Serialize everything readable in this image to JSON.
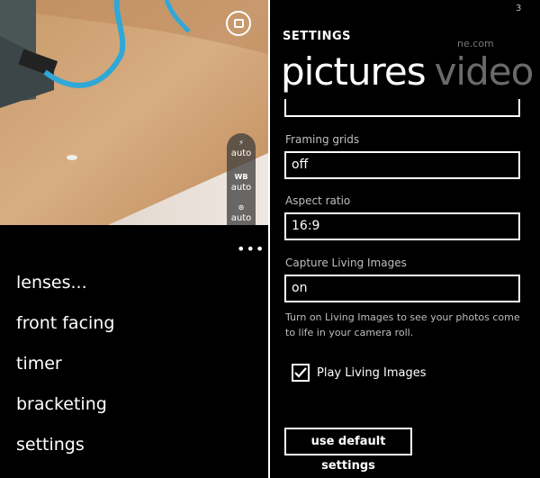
{
  "camera": {
    "switch_icon": "camera-switch-icon",
    "quick_settings": [
      {
        "icon": "flash-icon",
        "symbol": "⚡",
        "value": "auto"
      },
      {
        "icon": "white-balance-icon",
        "symbol": "WB",
        "value": "auto"
      },
      {
        "icon": "exposure-icon",
        "symbol": "⊙",
        "value": "auto"
      }
    ],
    "more_icon": "•••"
  },
  "menu": {
    "items": [
      "lenses...",
      "front facing",
      "timer",
      "bracketing",
      "settings"
    ]
  },
  "settings": {
    "status_number": "3",
    "watermark": "ne.com",
    "title": "SETTINGS",
    "pivot_active": "pictures",
    "pivot_inactive": "video",
    "framing_grids_label": "Framing grids",
    "framing_grids_value": "off",
    "aspect_ratio_label": "Aspect ratio",
    "aspect_ratio_value": "16:9",
    "living_images_label": "Capture Living Images",
    "living_images_value": "on",
    "living_help": "Turn on Living Images to see your photos come to life in your camera roll.",
    "play_living_label": "Play Living Images",
    "play_living_checked": true,
    "default_button": "use default settings"
  }
}
